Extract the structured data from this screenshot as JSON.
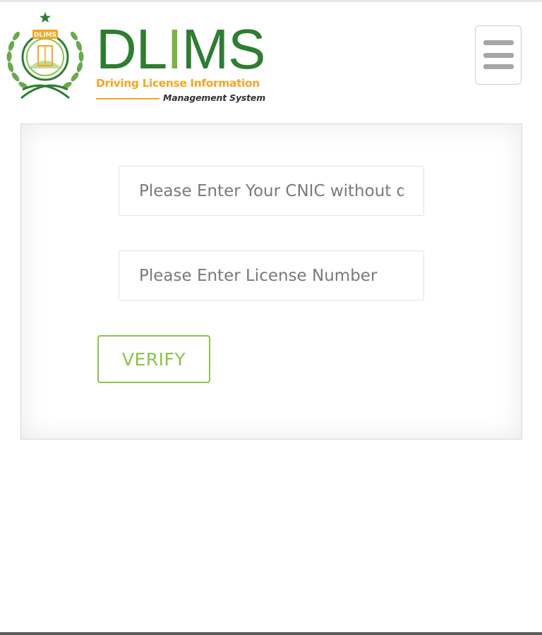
{
  "header": {
    "logo": {
      "emblem_text": "DLIMS",
      "wordmark_prefix": "DL",
      "wordmark_accent": "I",
      "wordmark_suffix": "MS",
      "tagline_line1": "Driving License Information",
      "tagline_line2": "Management System"
    },
    "menu_toggle_icon": "hamburger-icon"
  },
  "form": {
    "cnic": {
      "placeholder": "Please Enter Your CNIC without dashes",
      "value": ""
    },
    "license": {
      "placeholder": "Please Enter License Number",
      "value": ""
    },
    "verify_label": "VERIFY"
  },
  "colors": {
    "brand_dark_green": "#2e7d32",
    "brand_light_green": "#7cb342",
    "brand_orange": "#f5a623",
    "button_green": "#8bc34a",
    "menu_icon_gray": "#a6a6a6"
  }
}
